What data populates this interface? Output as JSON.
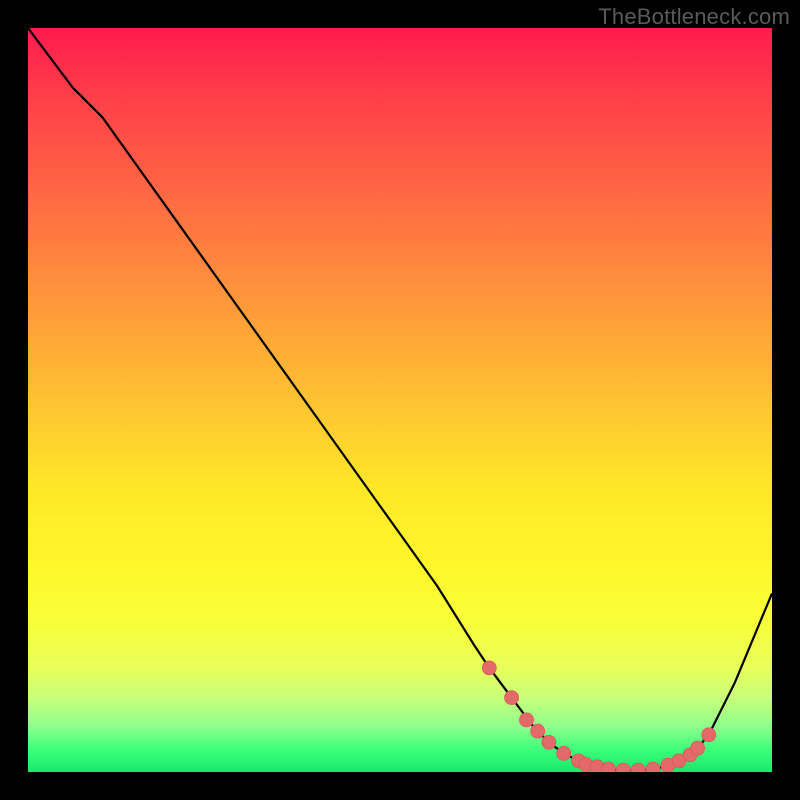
{
  "watermark": "TheBottleneck.com",
  "colors": {
    "line": "#000000",
    "dot_fill": "#e46a6a",
    "dot_stroke": "#d85a5a",
    "top_gradient": "#ff1a4f",
    "bottom_gradient": "#18e86a"
  },
  "chart_data": {
    "type": "line",
    "title": "",
    "xlabel": "",
    "ylabel": "",
    "xlim": [
      0,
      100
    ],
    "ylim": [
      0,
      100
    ],
    "x": [
      0,
      6,
      10,
      15,
      20,
      25,
      30,
      35,
      40,
      45,
      50,
      55,
      60,
      62,
      65,
      68,
      70,
      72,
      74,
      76,
      78,
      80,
      82,
      84,
      86,
      88,
      90,
      92,
      95,
      100
    ],
    "y": [
      100,
      92,
      88,
      81,
      74,
      67,
      60,
      53,
      46,
      39,
      32,
      25,
      17,
      14,
      10,
      6,
      4,
      2.5,
      1.5,
      0.8,
      0.4,
      0.2,
      0.2,
      0.4,
      0.8,
      1.6,
      3,
      6,
      12,
      24
    ],
    "dots_x": [
      62,
      65,
      67,
      68.5,
      70,
      72,
      74,
      75,
      76.5,
      78,
      80,
      82,
      84,
      86,
      87.5,
      89,
      90,
      91.5
    ],
    "dots_y": [
      14,
      10,
      7,
      5.5,
      4,
      2.5,
      1.5,
      1,
      0.7,
      0.4,
      0.25,
      0.25,
      0.4,
      0.9,
      1.5,
      2.3,
      3.2,
      5
    ]
  }
}
